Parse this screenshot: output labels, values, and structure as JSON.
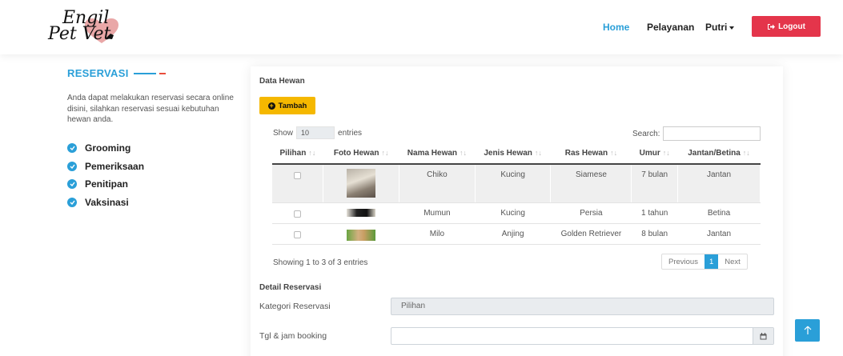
{
  "brand": {
    "logo_line1": "Engil",
    "logo_line2": "Pet Vet"
  },
  "nav": {
    "home": "Home",
    "pelayanan": "Pelayanan",
    "user": "Putri",
    "logout": "Logout"
  },
  "sidebar": {
    "title": "RESERVASI",
    "description": "Anda dapat melakukan reservasi secara online disini, silahkan reservasi sesuai kebutuhan hewan anda.",
    "services": [
      "Grooming",
      "Pemeriksaan",
      "Penitipan",
      "Vaksinasi"
    ]
  },
  "card": {
    "title": "Data Hewan",
    "add_button": "Tambah",
    "show_label": "Show",
    "length_value": "10",
    "entries_label": "entries",
    "search_label": "Search:",
    "columns": [
      "Pilihan",
      "Foto Hewan",
      "Nama Hewan",
      "Jenis Hewan",
      "Ras Hewan",
      "Umur",
      "Jantan/Betina"
    ],
    "rows": [
      {
        "nama": "Chiko",
        "jenis": "Kucing",
        "ras": "Siamese",
        "umur": "7 bulan",
        "kelamin": "Jantan"
      },
      {
        "nama": "Mumun",
        "jenis": "Kucing",
        "ras": "Persia",
        "umur": "1 tahun",
        "kelamin": "Betina"
      },
      {
        "nama": "Milo",
        "jenis": "Anjing",
        "ras": "Golden Retriever",
        "umur": "8 bulan",
        "kelamin": "Jantan"
      }
    ],
    "info": "Showing 1 to 3 of 3 entries",
    "pager": {
      "previous": "Previous",
      "page": "1",
      "next": "Next"
    }
  },
  "detail": {
    "title": "Detail Reservasi",
    "kategori_label": "Kategori Reservasi",
    "kategori_value": "Pilihan",
    "tgl_label": "Tgl & jam booking",
    "tgl_value": ""
  },
  "colors": {
    "accent": "#2a9fd8",
    "logout": "#e4354b",
    "tambah": "#f5b800"
  }
}
